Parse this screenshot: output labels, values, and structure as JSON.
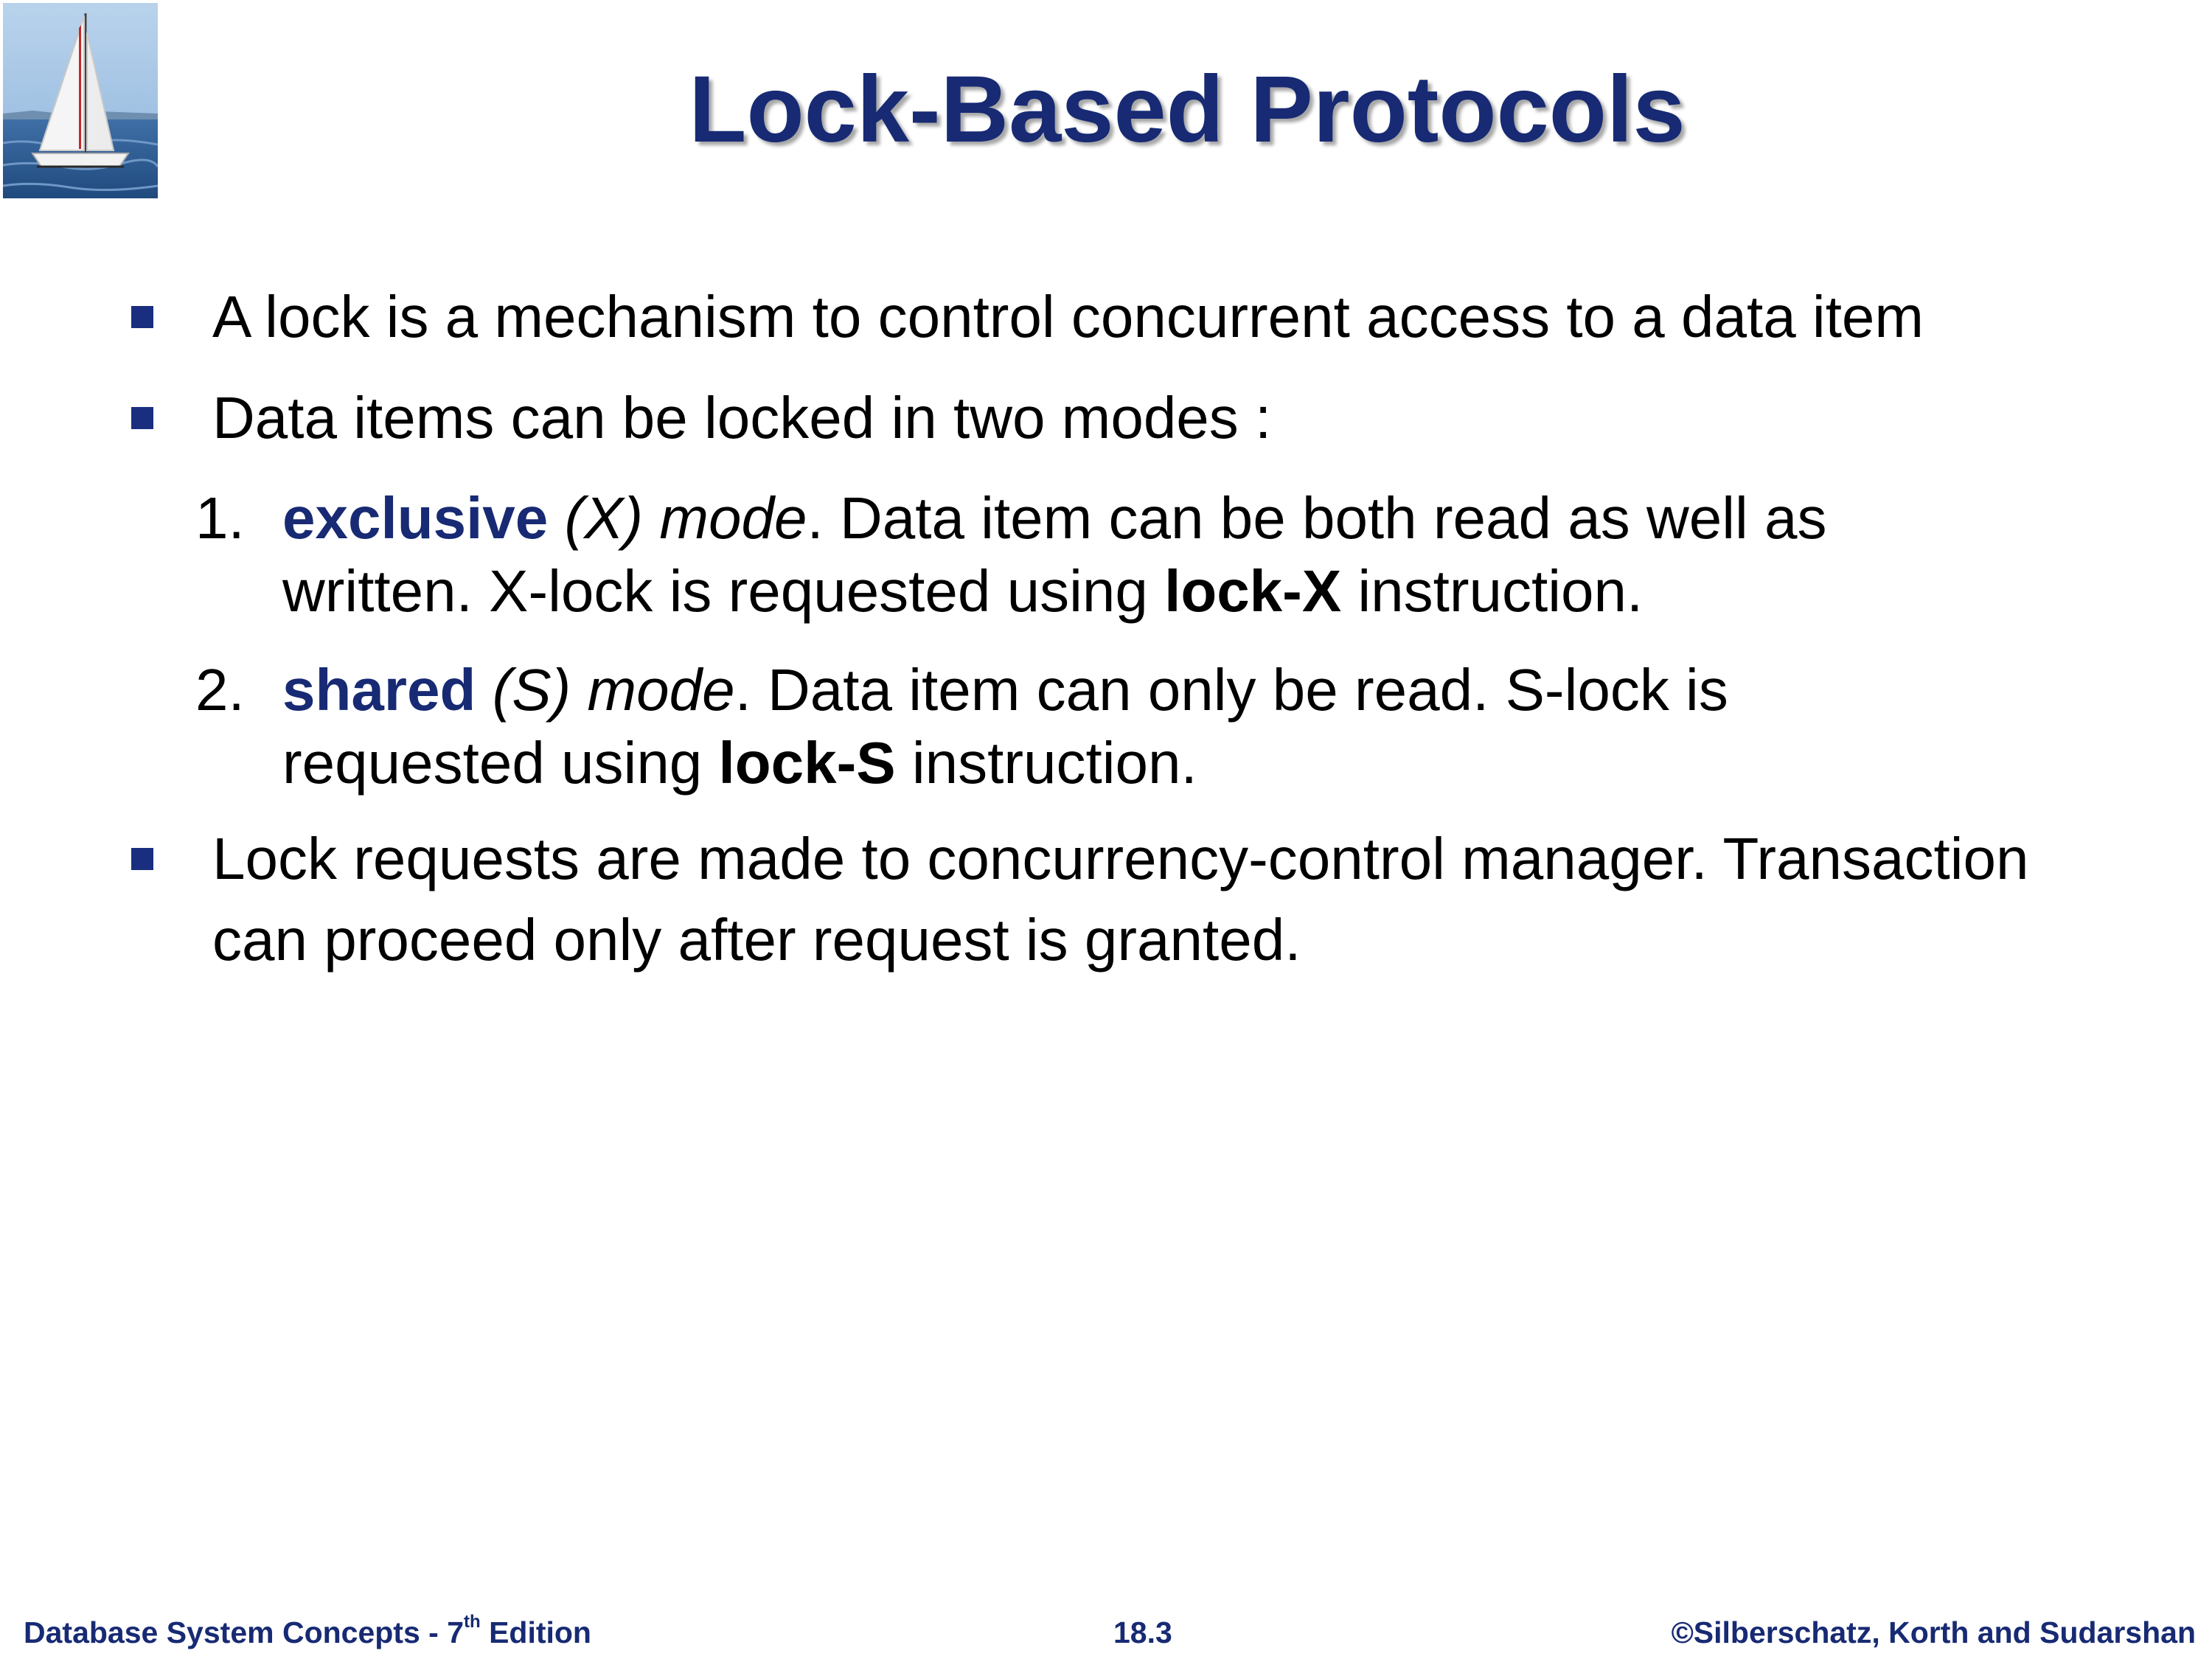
{
  "slide": {
    "title": "Lock-Based Protocols",
    "bullets": [
      "A lock is a mechanism to control concurrent access to a data item",
      "Data items can be locked in two modes :",
      "Lock requests are made to concurrency-control manager. Transaction",
      "can proceed only after request is granted."
    ],
    "modes": [
      {
        "number": "1.",
        "keyword": "exclusive",
        "notation": "(X) mode",
        "line1_rest": ". Data item can be both read as well  as",
        "line2_pre": "written. X-lock is requested using ",
        "instruction": "lock-X",
        "line2_post": " instruction."
      },
      {
        "number": "2.",
        "keyword": "shared",
        "notation": "(S) mode",
        "line1_rest": ". Data item can only be read. S-lock is",
        "line2_pre": "requested using ",
        "instruction": "lock-S",
        "line2_post": " instruction."
      }
    ]
  },
  "footer": {
    "book_prefix": "Database System Concepts - 7",
    "book_sup": "th",
    "book_suffix": " Edition",
    "page": "18.3",
    "copyright": "©Silberschatz, Korth and Sudarshan"
  },
  "colors": {
    "title": "#172a73",
    "bullet": "#1a2e7f",
    "keyword": "#172a73",
    "footer": "#172a73"
  },
  "icons": {
    "logo": "sailboat-logo"
  }
}
